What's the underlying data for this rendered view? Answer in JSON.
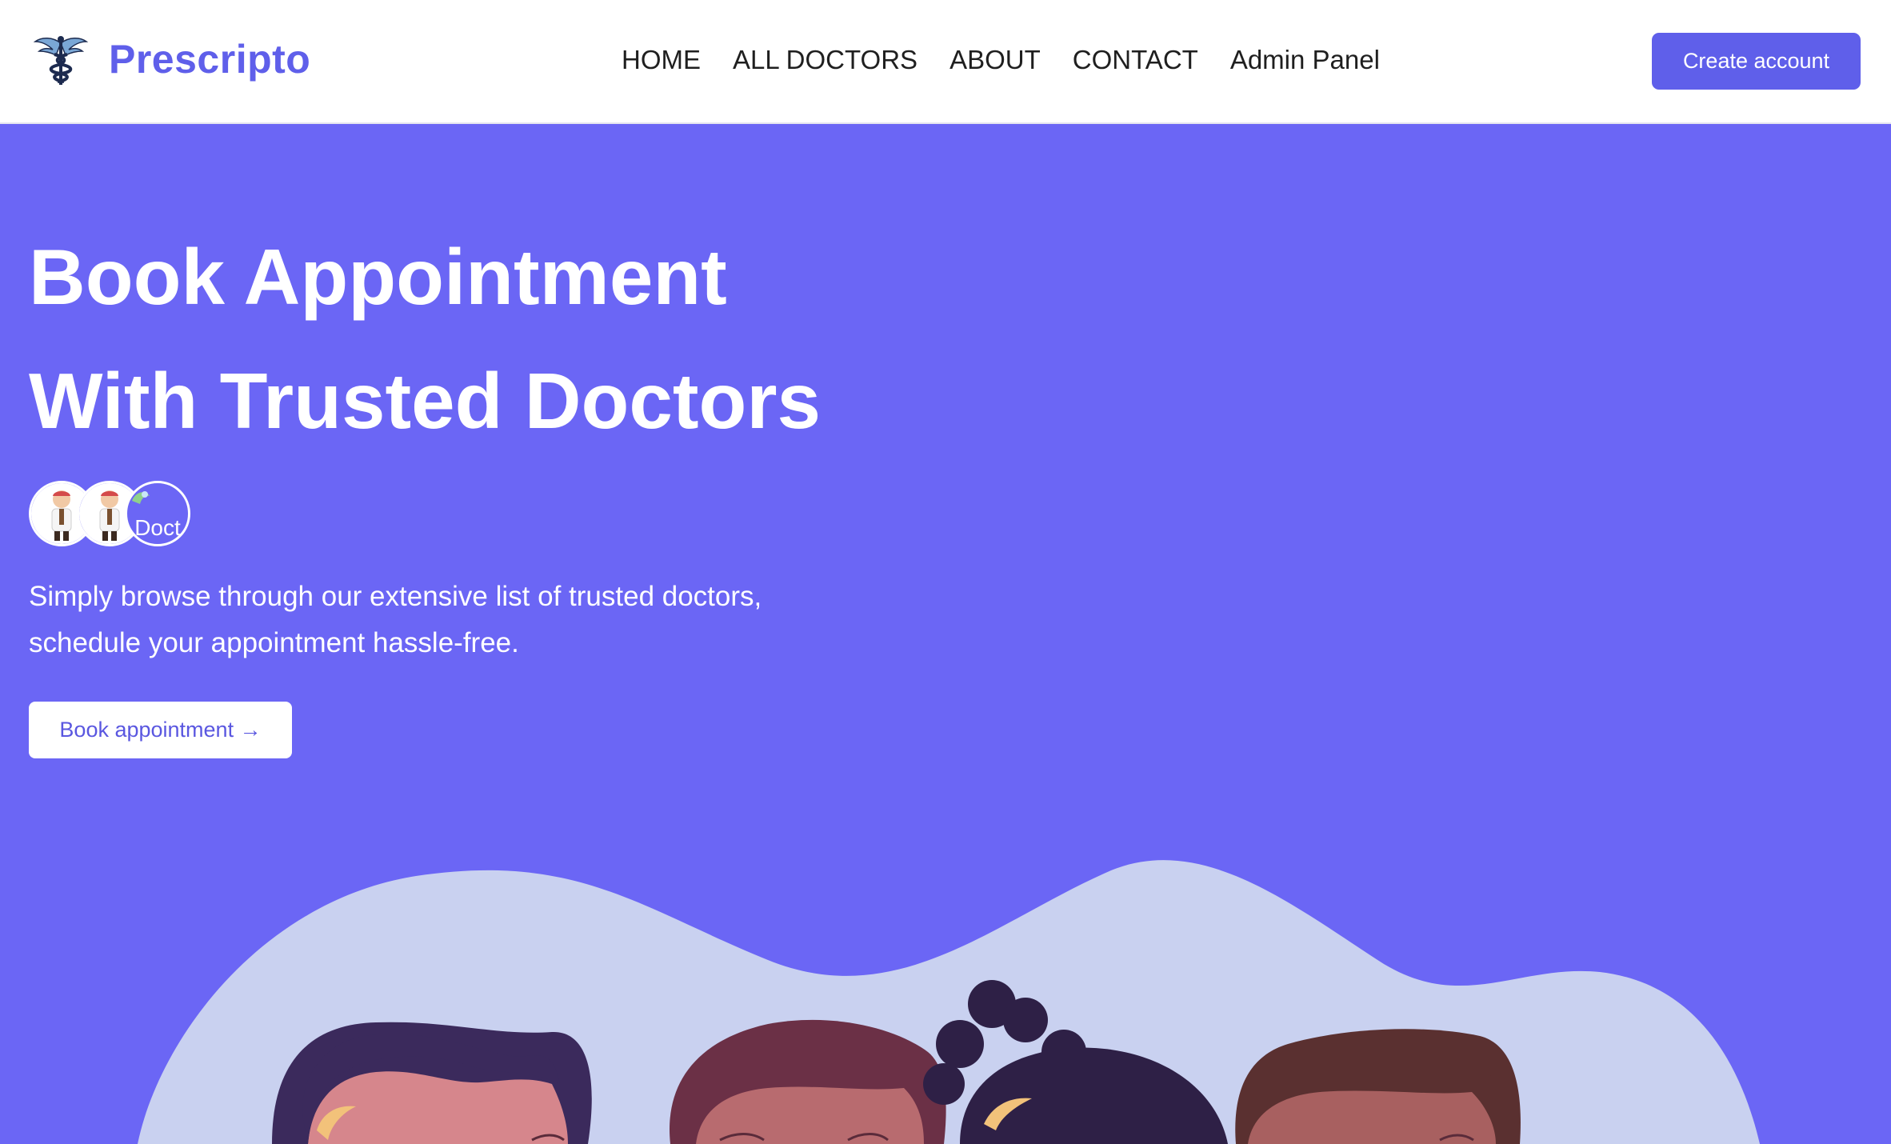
{
  "brand": {
    "name": "Prescripto",
    "logo_icon": "caduceus-icon"
  },
  "nav": {
    "links": [
      "HOME",
      "ALL DOCTORS",
      "ABOUT",
      "CONTACT",
      "Admin Panel"
    ]
  },
  "header": {
    "create_account_label": "Create account"
  },
  "hero": {
    "title_line1": "Book Appointment",
    "title_line2": "With Trusted Doctors",
    "avatars": [
      {
        "icon": "doctor-avatar-icon"
      },
      {
        "icon": "doctor-avatar-icon"
      },
      {
        "icon": "broken-image-icon",
        "alt_text": "Doct"
      }
    ],
    "description": "Simply browse through our extensive list of trusted doctors, schedule your appointment hassle-free.",
    "cta_label": "Book appointment →",
    "illustration": "doctors-group-illustration"
  },
  "colors": {
    "brand": "#5f5fea",
    "hero_background": "#6b66f5",
    "blob": "#c9d1f0",
    "text_dark": "#1f1f1f"
  }
}
